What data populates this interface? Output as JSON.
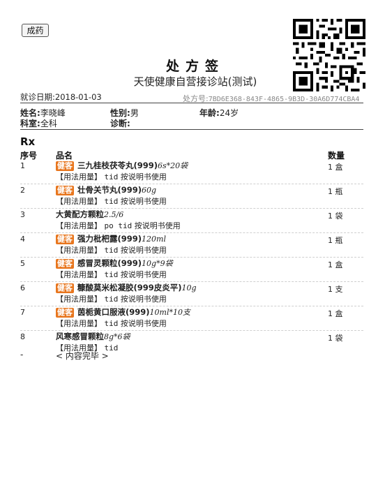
{
  "header": {
    "button_label": "成药",
    "title": "处方签",
    "clinic": "天使健康自营接诊站(测试)",
    "date_label": "就诊日期:",
    "date": "2018-01-03",
    "rx_no_label": "处方号:",
    "rx_no": "7BD6E368-843F-4865-9B3D-30A6D774CBA4"
  },
  "patient": {
    "name_label": "姓名:",
    "name": "李晓峰",
    "gender_label": "性别:",
    "gender": "男",
    "age_label": "年龄:",
    "age": "24岁",
    "dept_label": "科室:",
    "dept": "全科",
    "diagnosis_label": "诊断:",
    "diagnosis": ""
  },
  "rx_label": "Rx",
  "columns": {
    "seq": "序号",
    "name": "品名",
    "qty": "数量"
  },
  "items": [
    {
      "seq": "1",
      "tag": "健客",
      "name": "三九桂枝茯苓丸(999)",
      "spec": "6s*20袋",
      "usage_label": "【用法用量】",
      "usage_code": "tid",
      "usage_text": "按说明书使用",
      "qty": "1 盒"
    },
    {
      "seq": "2",
      "tag": "健客",
      "name": "壮骨关节丸(999)",
      "spec": "60g",
      "usage_label": "【用法用量】",
      "usage_code": "tid",
      "usage_text": "按说明书使用",
      "qty": "1 瓶"
    },
    {
      "seq": "3",
      "tag": "",
      "name": "大黄配方颗粒",
      "spec": "2.5/6",
      "usage_label": "【用法用量】",
      "usage_code": "po tid",
      "usage_text": "按说明书使用",
      "qty": "1 袋"
    },
    {
      "seq": "4",
      "tag": "健客",
      "name": "强力枇杷露(999)",
      "spec": "120ml",
      "usage_label": "【用法用量】",
      "usage_code": "tid",
      "usage_text": "按说明书使用",
      "qty": "1 瓶"
    },
    {
      "seq": "5",
      "tag": "健客",
      "name": "感冒灵颗粒(999)",
      "spec": "10g*9袋",
      "usage_label": "【用法用量】",
      "usage_code": "tid",
      "usage_text": "按说明书使用",
      "qty": "1 盒"
    },
    {
      "seq": "6",
      "tag": "健客",
      "name": "糠酸莫米松凝胶(999皮炎平)",
      "spec": "10g",
      "usage_label": "【用法用量】",
      "usage_code": "tid",
      "usage_text": "按说明书使用",
      "qty": "1 支"
    },
    {
      "seq": "7",
      "tag": "健客",
      "name": "茵栀黄口服液(999)",
      "spec": "10ml*10支",
      "usage_label": "【用法用量】",
      "usage_code": "tid",
      "usage_text": "按说明书使用",
      "qty": "1 盒"
    },
    {
      "seq": "8",
      "tag": "",
      "name": "风寒感冒颗粒",
      "spec": "8g*6袋",
      "usage_label": "【用法用量】",
      "usage_code": "tid",
      "usage_text": "",
      "qty": "1 袋"
    }
  ],
  "footer": {
    "dash": "-",
    "end_text": "< 内容完毕 >"
  },
  "colors": {
    "tag_bg": "#e8761e",
    "rule": "#444444"
  }
}
